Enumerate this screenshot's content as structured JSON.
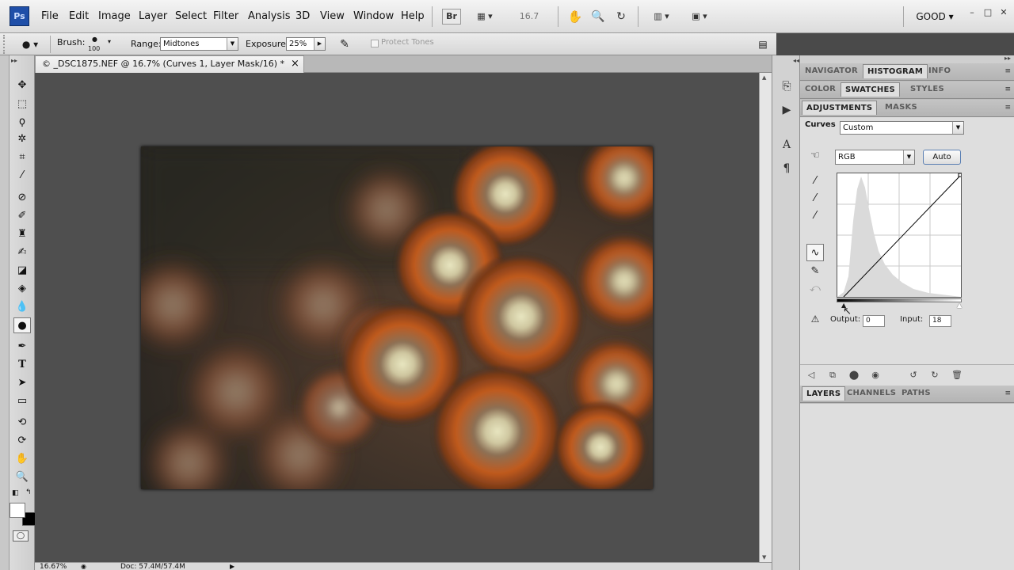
{
  "app": {
    "logo_text": "Ps"
  },
  "menu": {
    "items": [
      "File",
      "Edit",
      "Image",
      "Layer",
      "Select",
      "Filter",
      "Analysis",
      "3D",
      "View",
      "Window",
      "Help"
    ],
    "bridge_label": "Br",
    "zoom_value": "16.7",
    "workspace": "GOOD",
    "window_controls": [
      "–",
      "□",
      "✕"
    ]
  },
  "options": {
    "brush_label": "Brush:",
    "brush_size": "100",
    "range_label": "Range:",
    "range_value": "Midtones",
    "exposure_label": "Exposure:",
    "exposure_value": "25%",
    "protect_tones_label": "Protect Tones"
  },
  "document": {
    "tab_title": "© _DSC1875.NEF @ 16.7% (Curves 1, Layer Mask/16) *",
    "close_glyph": "×",
    "status_zoom": "16.67%",
    "status_doc": "Doc: 57.4M/57.4M"
  },
  "panels": {
    "group1_tabs": [
      "NAVIGATOR",
      "HISTOGRAM",
      "INFO"
    ],
    "group1_active": 1,
    "group2_tabs": [
      "COLOR",
      "SWATCHES",
      "STYLES"
    ],
    "group2_active": 1,
    "group3_tabs": [
      "ADJUSTMENTS",
      "MASKS"
    ],
    "group3_active": 0,
    "group4_tabs": [
      "LAYERS",
      "CHANNELS",
      "PATHS"
    ],
    "group4_active": 0,
    "curves": {
      "label": "Curves",
      "preset": "Custom",
      "channel": "RGB",
      "auto_label": "Auto",
      "output_label": "Output:",
      "output_value": "0",
      "input_label": "Input:",
      "input_value": "18"
    }
  }
}
